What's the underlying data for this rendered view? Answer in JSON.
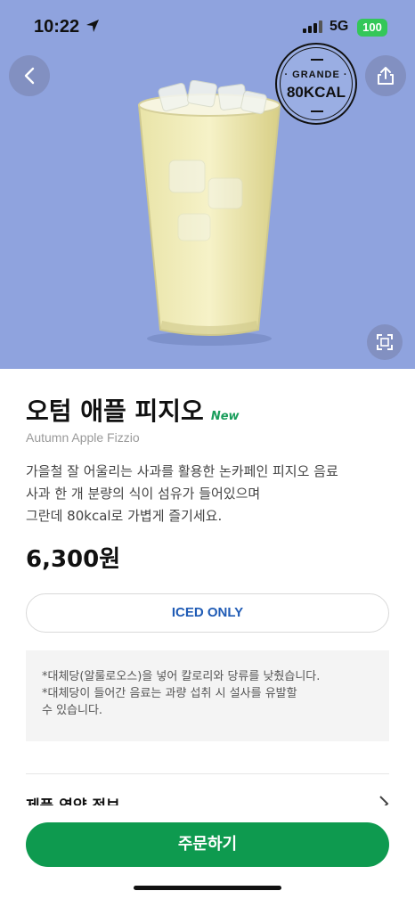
{
  "status_bar": {
    "time": "10:22",
    "network": "5G",
    "battery": "100"
  },
  "badge": {
    "size": "· GRANDE ·",
    "kcal": "80KCAL"
  },
  "product": {
    "name": "오텀 애플 피지오",
    "new_tag": "New",
    "english_name": "Autumn Apple Fizzio",
    "description_lines": [
      "가을철 잘 어울리는 사과를 활용한 논카페인 피지오 음료",
      "사과 한 개 분량의 식이 섬유가 들어있으며",
      "그란데 80kcal로 가볍게 즐기세요."
    ],
    "price": "6,300원"
  },
  "option": {
    "label": "ICED ONLY"
  },
  "notice": {
    "lines": [
      "*대체당(알룰로오스)을 넣어 칼로리와 당류를 낮췄습니다.",
      "*대체당이 들어간 음료는 과량 섭취 시 설사를 유발할",
      "수 있습니다."
    ]
  },
  "nutrition": {
    "label": "제품 영양 정보"
  },
  "order_button": {
    "label": "주문하기"
  },
  "colors": {
    "hero_bg": "#8fa3de",
    "brand_green": "#0e9a4f",
    "iced_blue": "#1f5bb5",
    "new_green": "#1a9e5c"
  },
  "icons": [
    "location-arrow-icon",
    "signal-icon",
    "back-arrow-icon",
    "share-icon",
    "expand-icon",
    "chevron-right-icon"
  ]
}
